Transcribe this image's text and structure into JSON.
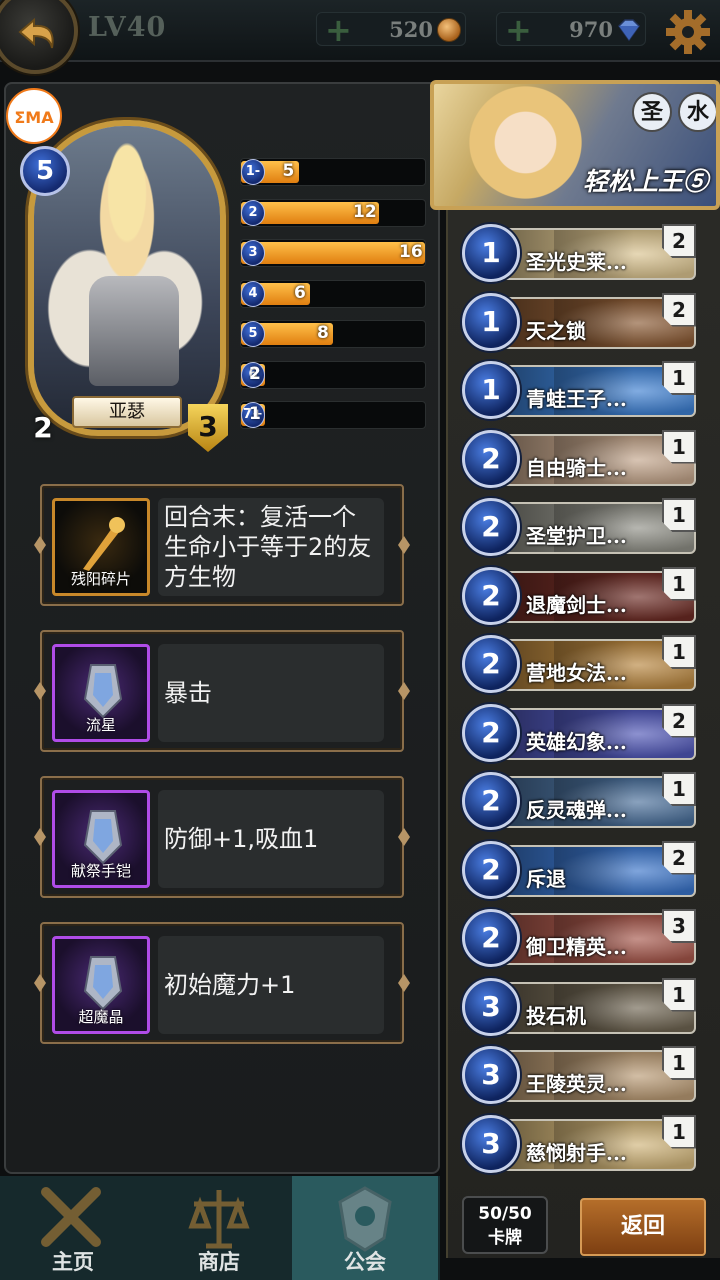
{
  "topbar": {
    "level": "LV40",
    "gold": "520",
    "gems": "970"
  },
  "watermark": "ΣMA",
  "hero": {
    "name": "亚瑟",
    "cost": "5",
    "attack": "2",
    "health": "3"
  },
  "mana_curve": [
    {
      "cost": "1-",
      "count": "5",
      "value": 5
    },
    {
      "cost": "2",
      "count": "12",
      "value": 12
    },
    {
      "cost": "3",
      "count": "16",
      "value": 16
    },
    {
      "cost": "4",
      "count": "6",
      "value": 6
    },
    {
      "cost": "5",
      "count": "8",
      "value": 8
    },
    {
      "cost": "6",
      "count": "2",
      "value": 2
    },
    {
      "cost": "7+",
      "count": "1",
      "value": 1
    }
  ],
  "abilities": [
    {
      "label": "残阳碎片",
      "text": "回合末：复活一个生命小于等于2的友方生物",
      "rarity": "gold"
    },
    {
      "label": "流星",
      "text": "暴击",
      "rarity": "purple"
    },
    {
      "label": "献祭手铠",
      "text": "防御+1,吸血1",
      "rarity": "purple"
    },
    {
      "label": "超魔晶",
      "text": "初始魔力+1",
      "rarity": "purple"
    }
  ],
  "deck": {
    "tags": [
      "圣",
      "水"
    ],
    "name": "轻松上王⑤",
    "cards": [
      {
        "cost": "1",
        "name": "圣光史莱...",
        "count": "2",
        "color": "#d9c28e"
      },
      {
        "cost": "1",
        "name": "天之锁",
        "count": "2",
        "color": "#8a5a34"
      },
      {
        "cost": "1",
        "name": "青蛙王子...",
        "count": "1",
        "color": "#3d7fd1"
      },
      {
        "cost": "2",
        "name": "自由骑士...",
        "count": "1",
        "color": "#c2a48a"
      },
      {
        "cost": "2",
        "name": "圣堂护卫...",
        "count": "1",
        "color": "#8f8f86"
      },
      {
        "cost": "2",
        "name": "退魔剑士...",
        "count": "1",
        "color": "#6c2b24"
      },
      {
        "cost": "2",
        "name": "营地女法...",
        "count": "1",
        "color": "#b8863f"
      },
      {
        "cost": "2",
        "name": "英雄幻象...",
        "count": "2",
        "color": "#4f56b6"
      },
      {
        "cost": "2",
        "name": "反灵魂弹...",
        "count": "1",
        "color": "#4a6f9a"
      },
      {
        "cost": "2",
        "name": "斥退",
        "count": "2",
        "color": "#3a74c9"
      },
      {
        "cost": "2",
        "name": "御卫精英...",
        "count": "3",
        "color": "#a5564a"
      },
      {
        "cost": "3",
        "name": "投石机",
        "count": "1",
        "color": "#6f6552"
      },
      {
        "cost": "3",
        "name": "王陵英灵...",
        "count": "1",
        "color": "#b99a74"
      },
      {
        "cost": "3",
        "name": "慈悯射手...",
        "count": "1",
        "color": "#cfb378"
      }
    ],
    "card_count_value": "50/50",
    "card_count_label": "卡牌",
    "return_label": "返回"
  },
  "nav": [
    {
      "label": "主页",
      "icon": "crossed-swords-icon"
    },
    {
      "label": "商店",
      "icon": "scales-icon"
    },
    {
      "label": "公会",
      "icon": "guild-crest-icon",
      "active": true
    }
  ]
}
